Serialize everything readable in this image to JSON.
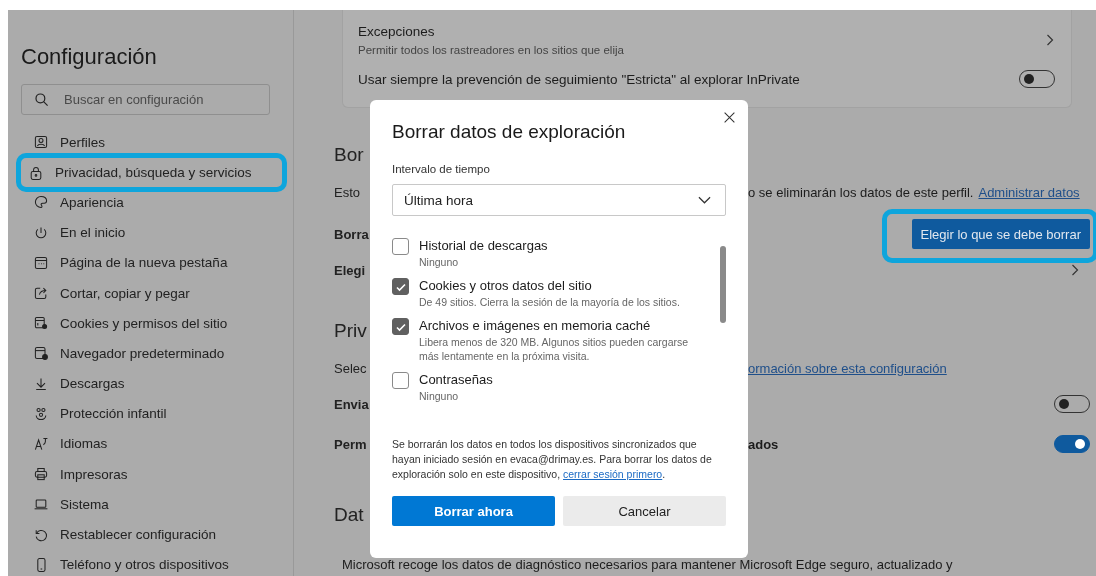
{
  "sidebar": {
    "title": "Configuración",
    "search": {
      "placeholder": "Buscar en configuración"
    },
    "items": [
      {
        "label": "Perfiles",
        "highlighted": false
      },
      {
        "label": "Privacidad, búsqueda y servicios",
        "highlighted": true
      },
      {
        "label": "Apariencia",
        "highlighted": false
      },
      {
        "label": "En el inicio",
        "highlighted": false
      },
      {
        "label": "Página de la nueva pestaña",
        "highlighted": false
      },
      {
        "label": "Cortar, copiar y pegar",
        "highlighted": false
      },
      {
        "label": "Cookies y permisos del sitio",
        "highlighted": false
      },
      {
        "label": "Navegador predeterminado",
        "highlighted": false
      },
      {
        "label": "Descargas",
        "highlighted": false
      },
      {
        "label": "Protección infantil",
        "highlighted": false
      },
      {
        "label": "Idiomas",
        "highlighted": false
      },
      {
        "label": "Impresoras",
        "highlighted": false
      },
      {
        "label": "Sistema",
        "highlighted": false
      },
      {
        "label": "Restablecer configuración",
        "highlighted": false
      },
      {
        "label": "Teléfono y otros dispositivos",
        "highlighted": false
      }
    ]
  },
  "tracking_card": {
    "exceptions": {
      "title": "Excepciones",
      "description": "Permitir todos los rastreadores en los sitios que elija"
    },
    "strict_inprivate": {
      "label": "Usar siempre la prevención de seguimiento \"Estricta\" al explorar InPrivate",
      "on": false
    }
  },
  "background_rows": [
    {
      "kind": "heading",
      "left": "Bor"
    },
    {
      "kind": "text",
      "left": "Esto",
      "right": "o se eliminarán los datos de este perfil.",
      "link": "Administrar datos"
    },
    {
      "kind": "button",
      "left": "Borra",
      "button": "Elegir lo que se debe borrar",
      "highlighted": true
    },
    {
      "kind": "chevron",
      "left": "Elegi"
    },
    {
      "kind": "heading",
      "left": "Priv"
    },
    {
      "kind": "link",
      "left": "Selec",
      "link": "ormación sobre esta configuración"
    },
    {
      "kind": "toggle",
      "left": "Envia",
      "on": false
    },
    {
      "kind": "toggle",
      "left": "Perm",
      "right": "ados",
      "on": true
    },
    {
      "kind": "heading",
      "left": "Dat"
    }
  ],
  "footer_text": "Microsoft recoge los datos de diagnóstico necesarios para mantener Microsoft Edge seguro, actualizado y",
  "dialog": {
    "title": "Borrar datos de exploración",
    "range_label": "Intervalo de tiempo",
    "range_value": "Última hora",
    "items": [
      {
        "title": "Historial de descargas",
        "detail": "Ninguno",
        "checked": false
      },
      {
        "title": "Cookies y otros datos del sitio",
        "detail": "De 49 sitios. Cierra la sesión de la mayoría de los sitios.",
        "checked": true
      },
      {
        "title": "Archivos e imágenes en memoria caché",
        "detail": "Libera menos de 320 MB. Algunos sitios pueden cargarse más lentamente en la próxima visita.",
        "checked": true
      },
      {
        "title": "Contraseñas",
        "detail": "Ninguno",
        "checked": false
      }
    ],
    "note": "Se borrarán los datos en todos los dispositivos sincronizados que hayan iniciado sesión en evaca@drimay.es. Para borrar los datos de exploración solo en este dispositivo,",
    "note_link": "cerrar sesión primero",
    "note_end": ".",
    "buttons": [
      {
        "label": "Borrar ahora",
        "kind": "primary"
      },
      {
        "label": "Cancelar",
        "kind": "secondary"
      }
    ]
  }
}
